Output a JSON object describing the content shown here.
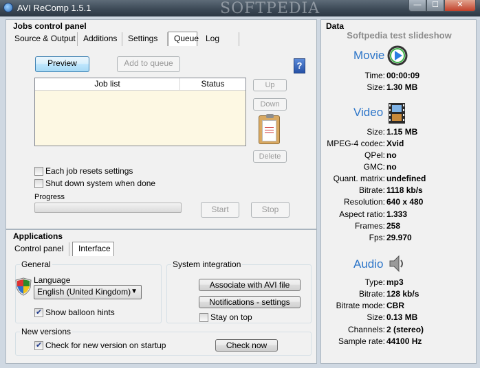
{
  "window": {
    "title": "AVI ReComp  1.5.1",
    "watermark": "SOFTPEDIA",
    "minimize": "—",
    "maximize": "☐",
    "close": "✕"
  },
  "jobs": {
    "header": "Jobs control panel",
    "tabs": [
      "Source & Output",
      "Additions",
      "Settings",
      "Queue",
      "Log"
    ],
    "active_tab": "Queue",
    "preview_label": "Preview",
    "add_label": "Add to queue",
    "help_label": "?",
    "columns": [
      "Job list",
      "Status"
    ],
    "up_label": "Up",
    "down_label": "Down",
    "delete_label": "Delete",
    "reset_label": "Each job resets settings",
    "shutdown_label": "Shut down system when done",
    "progress_label": "Progress",
    "progress_value": 0,
    "start_label": "Start",
    "stop_label": "Stop"
  },
  "applications": {
    "header": "Applications",
    "tabs": [
      "Control panel",
      "Interface"
    ],
    "active_tab": "Interface",
    "general_label": "General",
    "language_label": "Language",
    "language_value": "English (United Kingdom)",
    "balloon_label": "Show balloon hints",
    "balloon_checked": true,
    "sysint_label": "System integration",
    "associate_label": "Associate with AVI file",
    "notifications_label": "Notifications - settings",
    "stay_label": "Stay on top",
    "stay_checked": false,
    "newver_label": "New versions",
    "check_startup_label": "Check for new version on startup",
    "check_startup_checked": true,
    "check_now_label": "Check now"
  },
  "data": {
    "header": "Data",
    "slideshow": "Softpedia test slideshow",
    "movie": {
      "label": "Movie",
      "rows": [
        [
          "Time:",
          "00:00:09"
        ],
        [
          "Size:",
          "1.30 MB"
        ]
      ]
    },
    "video": {
      "label": "Video",
      "rows": [
        [
          "Size:",
          "1.15 MB"
        ],
        [
          "MPEG-4 codec:",
          "Xvid"
        ],
        [
          "QPel:",
          "no"
        ],
        [
          "GMC:",
          "no"
        ],
        [
          "Quant. matrix:",
          "undefined"
        ],
        [
          "Bitrate:",
          "1118 kb/s"
        ],
        [
          "Resolution:",
          "640 x 480"
        ],
        [
          "Aspect ratio:",
          "1.333"
        ],
        [
          "Frames:",
          "258"
        ],
        [
          "Fps:",
          "29.970"
        ]
      ]
    },
    "audio": {
      "label": "Audio",
      "rows": [
        [
          "Type:",
          "mp3"
        ],
        [
          "Bitrate:",
          "128 kb/s"
        ],
        [
          "Bitrate mode:",
          "CBR"
        ],
        [
          "Size:",
          "0.13 MB"
        ],
        [
          "Channels:",
          "2 (stereo)"
        ],
        [
          "Sample rate:",
          "44100 Hz"
        ]
      ]
    }
  }
}
